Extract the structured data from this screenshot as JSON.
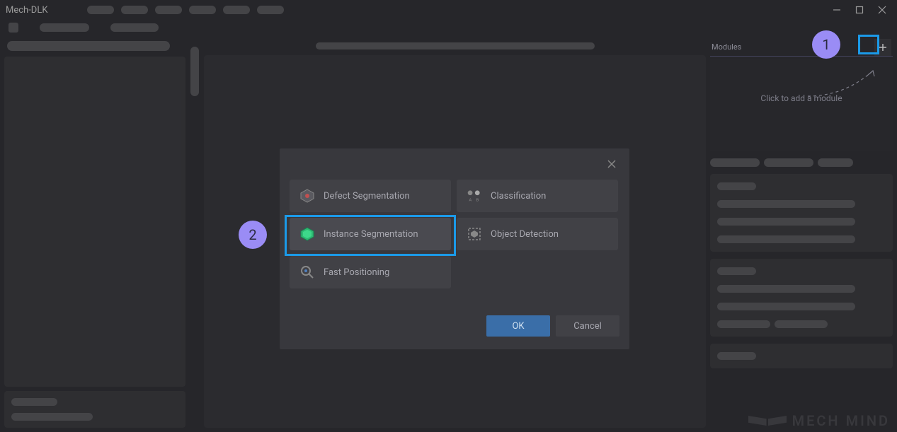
{
  "app": {
    "title": "Mech-DLK"
  },
  "right": {
    "modulesLabel": "Modules",
    "addHint": "Click to add a module"
  },
  "modal": {
    "options": {
      "defectSegmentation": "Defect Segmentation",
      "classification": "Classification",
      "instanceSegmentation": "Instance Segmentation",
      "objectDetection": "Object Detection",
      "fastPositioning": "Fast Positioning"
    },
    "buttons": {
      "ok": "OK",
      "cancel": "Cancel"
    }
  },
  "annotations": {
    "one": "1",
    "two": "2"
  },
  "watermark": {
    "text": "MECH MIND"
  }
}
